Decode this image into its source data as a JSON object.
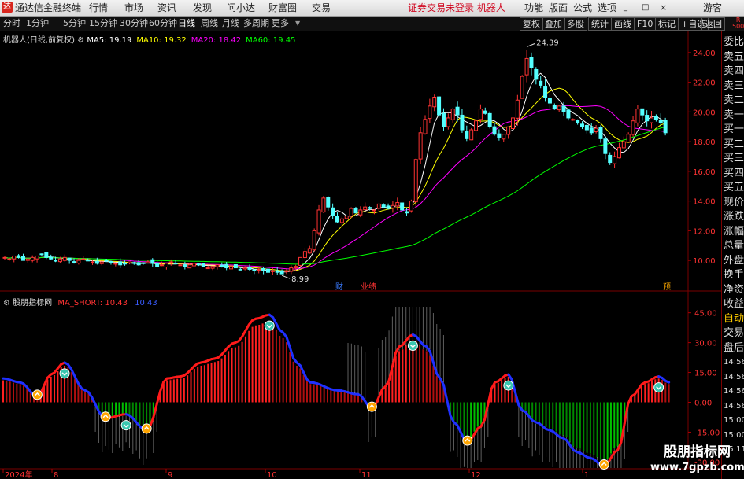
{
  "app": {
    "logo_glyph": "达",
    "title": "通达信金融终端",
    "menu": [
      "行情",
      "市场",
      "资讯",
      "发现",
      "问小达",
      "财富圈",
      "交易"
    ],
    "notice": "证券交易未登录 机器人",
    "right_menu": [
      "功能",
      "版面",
      "公式",
      "选项"
    ],
    "guest": "游客",
    "window_controls": [
      "_",
      "□",
      "×"
    ]
  },
  "toolbar": {
    "periods": [
      "分时",
      "1分钟",
      "5分钟",
      "15分钟",
      "30分钟",
      "60分钟",
      "日线",
      "周线",
      "月线",
      "多周期",
      "更多"
    ],
    "active_period": "日线",
    "buttons": [
      "复权",
      "叠加",
      "多股",
      "统计",
      "画线",
      "F10",
      "标记",
      "+自选",
      "返回"
    ]
  },
  "main_chart": {
    "stock_info": "机器人(日线,前复权)",
    "ma_labels": [
      {
        "text": "MA5: 19.19",
        "color": "#ffffff"
      },
      {
        "text": "MA10: 19.32",
        "color": "#ffff00"
      },
      {
        "text": "MA20: 18.42",
        "color": "#ff00ff"
      },
      {
        "text": "MA60: 19.45",
        "color": "#00ff00"
      }
    ],
    "high_label": "24.39",
    "low_label": "8.99",
    "event_markers": [
      "财",
      "业绩",
      "预"
    ],
    "y_ticks": [
      "24.00",
      "22.00",
      "20.00",
      "18.00",
      "16.00",
      "14.00",
      "12.00",
      "10.00"
    ],
    "y_values": [
      24,
      22,
      20,
      18,
      16,
      14,
      12,
      10
    ]
  },
  "indicator": {
    "name": "股朋指标网",
    "line_label": "MA_SHORT: 10.43",
    "line_value": "10.43",
    "y_ticks": [
      "45.00",
      "30.00",
      "15.00",
      "0.00",
      "-15.00",
      "-30.00"
    ],
    "y_values": [
      45,
      30,
      15,
      0,
      -15,
      -30
    ]
  },
  "x_axis": {
    "labels": [
      "2024年",
      "8",
      "9",
      "10",
      "11",
      "12",
      "1"
    ]
  },
  "right_panel": {
    "top": "R\n500",
    "items": [
      "委比",
      "卖五",
      "卖四",
      "卖三",
      "卖二",
      "卖一",
      "买一",
      "买二",
      "买三",
      "买四",
      "买五",
      "现价",
      "涨跌",
      "涨幅",
      "总量",
      "外盘",
      "换手",
      "净资",
      "收益",
      "自动",
      "交易",
      "盘后",
      "14:56",
      "14:56",
      "14:56",
      "14:56",
      "15:00",
      "15:00",
      "15:11"
    ]
  },
  "watermark": {
    "line1": "股朋指标网",
    "line2": "www.7gpzb.com"
  },
  "chart_data": [
    {
      "type": "candlestick",
      "title": "机器人(日线,前复权)",
      "ylim": [
        9,
        25
      ],
      "close_series": [
        10.2,
        10.1,
        10.3,
        10.2,
        10.0,
        10.1,
        10.2,
        10.3,
        10.4,
        10.2,
        10.1,
        10.0,
        10.1,
        10.2,
        10.0,
        9.9,
        10.0,
        10.1,
        10.0,
        9.9,
        9.8,
        9.9,
        10.0,
        9.9,
        9.8,
        9.7,
        9.8,
        9.9,
        9.8,
        9.7,
        9.8,
        9.9,
        9.8,
        9.6,
        9.7,
        9.8,
        9.9,
        9.8,
        9.7,
        9.6,
        9.7,
        9.8,
        9.7,
        9.6,
        9.5,
        9.6,
        9.7,
        9.6,
        9.5,
        9.6,
        9.5,
        9.4,
        9.5,
        9.4,
        9.3,
        9.4,
        9.3,
        9.2,
        9.3,
        9.2,
        9.1,
        9.3,
        9.5,
        9.6,
        10.2,
        10.6,
        10.8,
        12.0,
        13.4,
        14.2,
        13.6,
        13.0,
        12.6,
        12.8,
        13.0,
        13.5,
        13.2,
        13.4,
        13.6,
        13.5,
        13.4,
        13.8,
        13.6,
        13.5,
        13.7,
        13.9,
        13.4,
        13.2,
        14.0,
        16.8,
        18.6,
        19.5,
        20.4,
        21.0,
        19.8,
        19.0,
        19.6,
        20.2,
        19.8,
        18.8,
        18.2,
        18.8,
        19.4,
        20.2,
        19.9,
        19.0,
        18.5,
        18.3,
        18.5,
        19.0,
        19.6,
        20.8,
        22.4,
        23.6,
        23.0,
        22.2,
        21.8,
        21.0,
        20.6,
        20.2,
        20.4,
        20.0,
        19.6,
        19.5,
        19.3,
        19.0,
        18.8,
        18.6,
        18.9,
        18.2,
        17.2,
        16.6,
        17.0,
        17.6,
        18.0,
        18.5,
        19.4,
        20.2,
        19.8,
        19.4,
        19.6,
        19.5,
        19.3,
        18.6
      ],
      "highlighted_high": 24.39,
      "highlighted_low": 8.99,
      "ma": {
        "MA5": 19.19,
        "MA10": 19.32,
        "MA20": 18.42,
        "MA60": 19.45
      }
    },
    {
      "type": "bar",
      "title": "股朋指标网",
      "ylim": [
        -33,
        50
      ],
      "series": [
        {
          "name": "MA_SHORT",
          "last": 10.43
        }
      ],
      "profile": [
        [
          0,
          12
        ],
        [
          5,
          10
        ],
        [
          10,
          3
        ],
        [
          14,
          14
        ],
        [
          18,
          20
        ],
        [
          24,
          6
        ],
        [
          30,
          -8
        ],
        [
          36,
          -6
        ],
        [
          42,
          -14
        ],
        [
          48,
          12
        ],
        [
          52,
          13
        ],
        [
          58,
          20
        ],
        [
          62,
          22
        ],
        [
          68,
          30
        ],
        [
          74,
          42
        ],
        [
          78,
          44
        ],
        [
          82,
          35
        ],
        [
          86,
          20
        ],
        [
          90,
          10
        ],
        [
          98,
          6
        ],
        [
          104,
          4
        ],
        [
          108,
          -3
        ],
        [
          112,
          8
        ],
        [
          116,
          28
        ],
        [
          120,
          34
        ],
        [
          124,
          28
        ],
        [
          128,
          12
        ],
        [
          132,
          -10
        ],
        [
          136,
          -20
        ],
        [
          140,
          -12
        ],
        [
          144,
          10
        ],
        [
          148,
          14
        ],
        [
          152,
          -4
        ],
        [
          156,
          -10
        ],
        [
          160,
          -14
        ],
        [
          164,
          -18
        ],
        [
          168,
          -25
        ],
        [
          172,
          -28
        ],
        [
          176,
          -32
        ],
        [
          180,
          -24
        ],
        [
          184,
          3
        ],
        [
          188,
          10
        ],
        [
          192,
          13
        ],
        [
          195,
          10
        ]
      ]
    }
  ]
}
